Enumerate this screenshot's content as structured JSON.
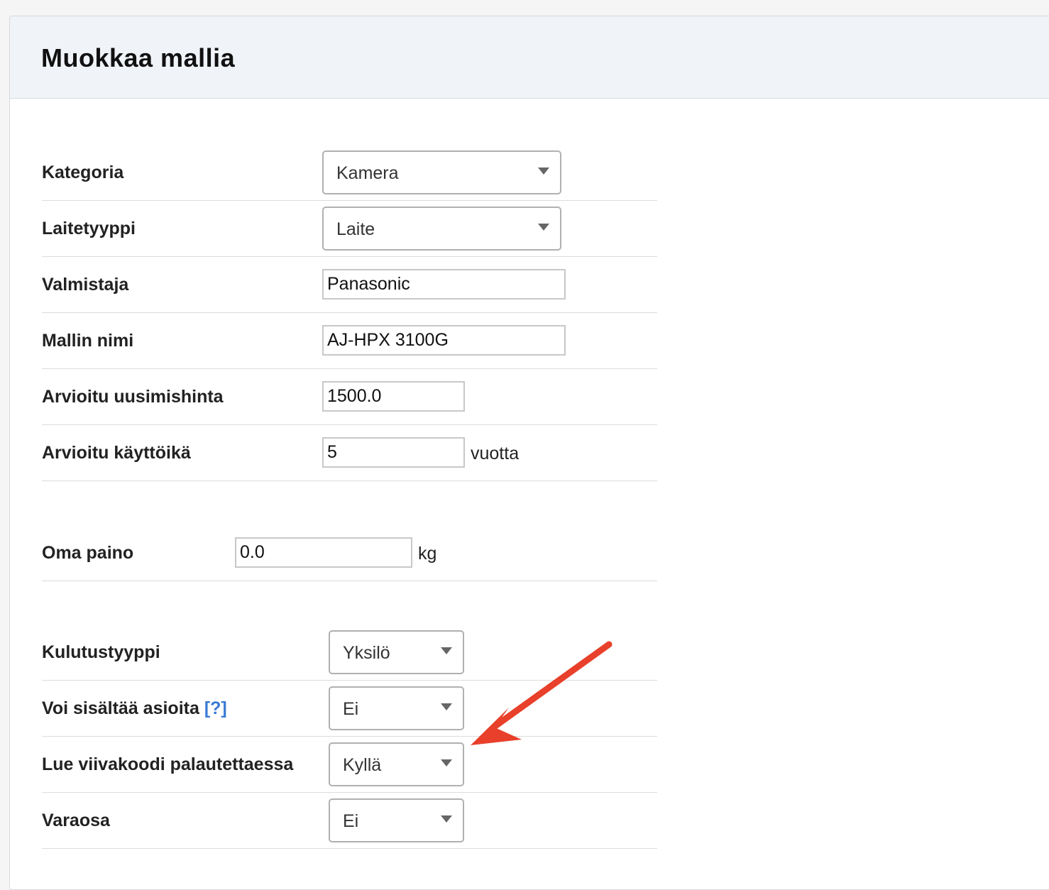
{
  "header": {
    "title": "Muokkaa mallia"
  },
  "form": {
    "kategoria": {
      "label": "Kategoria",
      "value": "Kamera"
    },
    "laitetyyppi": {
      "label": "Laitetyyppi",
      "value": "Laite"
    },
    "valmistaja": {
      "label": "Valmistaja",
      "value": "Panasonic"
    },
    "mallin_nimi": {
      "label": "Mallin nimi",
      "value": "AJ-HPX 3100G"
    },
    "uusimishinta": {
      "label": "Arvioitu uusimishinta",
      "value": "1500.0"
    },
    "kayttoika": {
      "label": "Arvioitu käyttöikä",
      "value": "5",
      "unit": "vuotta"
    },
    "oma_paino": {
      "label": "Oma paino",
      "value": "0.0",
      "unit": "kg"
    },
    "kulutustyyppi": {
      "label": "Kulutustyyppi",
      "value": "Yksilö"
    },
    "voi_sisaltaa": {
      "label": "Voi sisältää asioita",
      "help": "[?]",
      "value": "Ei"
    },
    "lue_viivakoodi": {
      "label": "Lue viivakoodi palautettaessa",
      "value": "Kyllä"
    },
    "varaosa": {
      "label": "Varaosa",
      "value": "Ei"
    }
  },
  "annotation": {
    "arrow_color": "#e8402a"
  },
  "colors": {
    "header_bg": "#f0f3f8",
    "link": "#3a7bd5"
  }
}
